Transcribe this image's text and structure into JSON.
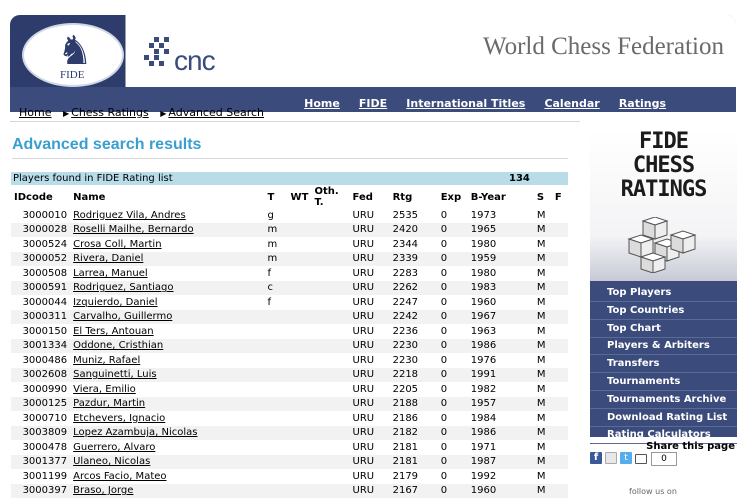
{
  "header": {
    "logo_text": "FIDE",
    "cnc_text": "cnc",
    "site_title": "World Chess Federation",
    "nav": [
      "Home",
      "FIDE",
      "International Titles",
      "Calendar",
      "Ratings"
    ]
  },
  "breadcrumb": [
    "Home",
    "Chess Ratings",
    "Advanced Search"
  ],
  "page_title": "Advanced search results",
  "results": {
    "found_label": "Players found in FIDE Rating list",
    "found_count": "134",
    "columns": [
      "IDcode",
      "Name",
      "T",
      "WT",
      "Oth. T.",
      "Fed",
      "Rtg",
      "Exp",
      "B-Year",
      "S",
      "F"
    ],
    "rows": [
      {
        "id": "3000010",
        "name": "Rodriguez Vila, Andres",
        "t": "g",
        "fed": "URU",
        "rtg": "2535",
        "exp": "0",
        "byear": "1973",
        "s": "M"
      },
      {
        "id": "3000028",
        "name": "Roselli Mailhe, Bernardo",
        "t": "m",
        "fed": "URU",
        "rtg": "2420",
        "exp": "0",
        "byear": "1965",
        "s": "M"
      },
      {
        "id": "3000524",
        "name": "Crosa Coll, Martin",
        "t": "m",
        "fed": "URU",
        "rtg": "2344",
        "exp": "0",
        "byear": "1980",
        "s": "M"
      },
      {
        "id": "3000052",
        "name": "Rivera, Daniel",
        "t": "m",
        "fed": "URU",
        "rtg": "2339",
        "exp": "0",
        "byear": "1959",
        "s": "M"
      },
      {
        "id": "3000508",
        "name": "Larrea, Manuel",
        "t": "f",
        "fed": "URU",
        "rtg": "2283",
        "exp": "0",
        "byear": "1980",
        "s": "M"
      },
      {
        "id": "3000591",
        "name": "Rodriguez, Santiago",
        "t": "c",
        "fed": "URU",
        "rtg": "2262",
        "exp": "0",
        "byear": "1983",
        "s": "M"
      },
      {
        "id": "3000044",
        "name": "Izquierdo, Daniel",
        "t": "f",
        "fed": "URU",
        "rtg": "2247",
        "exp": "0",
        "byear": "1960",
        "s": "M"
      },
      {
        "id": "3000311",
        "name": "Carvalho, Guillermo",
        "t": "",
        "fed": "URU",
        "rtg": "2242",
        "exp": "0",
        "byear": "1967",
        "s": "M"
      },
      {
        "id": "3000150",
        "name": "El Ters, Antouan",
        "t": "",
        "fed": "URU",
        "rtg": "2236",
        "exp": "0",
        "byear": "1963",
        "s": "M"
      },
      {
        "id": "3001334",
        "name": "Oddone, Cristhian",
        "t": "",
        "fed": "URU",
        "rtg": "2230",
        "exp": "0",
        "byear": "1986",
        "s": "M"
      },
      {
        "id": "3000486",
        "name": "Muniz, Rafael",
        "t": "",
        "fed": "URU",
        "rtg": "2230",
        "exp": "0",
        "byear": "1976",
        "s": "M"
      },
      {
        "id": "3002608",
        "name": "Sanguinetti, Luis",
        "t": "",
        "fed": "URU",
        "rtg": "2218",
        "exp": "0",
        "byear": "1991",
        "s": "M"
      },
      {
        "id": "3000990",
        "name": "Viera, Emilio",
        "t": "",
        "fed": "URU",
        "rtg": "2205",
        "exp": "0",
        "byear": "1982",
        "s": "M"
      },
      {
        "id": "3000125",
        "name": "Pazdur, Martin",
        "t": "",
        "fed": "URU",
        "rtg": "2188",
        "exp": "0",
        "byear": "1957",
        "s": "M"
      },
      {
        "id": "3000710",
        "name": "Etchevers, Ignacio",
        "t": "",
        "fed": "URU",
        "rtg": "2186",
        "exp": "0",
        "byear": "1984",
        "s": "M"
      },
      {
        "id": "3003809",
        "name": "Lopez Azambuja, Nicolas",
        "t": "",
        "fed": "URU",
        "rtg": "2182",
        "exp": "0",
        "byear": "1986",
        "s": "M"
      },
      {
        "id": "3000478",
        "name": "Guerrero, Alvaro",
        "t": "",
        "fed": "URU",
        "rtg": "2181",
        "exp": "0",
        "byear": "1971",
        "s": "M"
      },
      {
        "id": "3001377",
        "name": "Ulaneo, Nicolas",
        "t": "",
        "fed": "URU",
        "rtg": "2181",
        "exp": "0",
        "byear": "1987",
        "s": "M"
      },
      {
        "id": "3001199",
        "name": "Arcos Facio, Mateo",
        "t": "",
        "fed": "URU",
        "rtg": "2179",
        "exp": "0",
        "byear": "1992",
        "s": "M"
      },
      {
        "id": "3000397",
        "name": "Braso, Jorge",
        "t": "",
        "fed": "URU",
        "rtg": "2167",
        "exp": "0",
        "byear": "1960",
        "s": "M"
      }
    ]
  },
  "sidebar": {
    "banner_lines": [
      "FIDE",
      "CHESS",
      "RATINGS"
    ],
    "items": [
      "Top Players",
      "Top Countries",
      "Top Chart",
      "Players & Arbiters",
      "Transfers",
      "Tournaments",
      "Tournaments Archive",
      "Download Rating List",
      "Rating Calculators"
    ]
  },
  "share": {
    "label": "Share this page",
    "count": "0",
    "icons": [
      "facebook-icon",
      "email-icon",
      "twitter-icon",
      "print-icon"
    ]
  },
  "footer": {
    "follow_text": "follow us on"
  },
  "colors": {
    "brand": "#3b4b7b",
    "accent": "#3a9fd0",
    "result_bar": "#b8dce8"
  }
}
